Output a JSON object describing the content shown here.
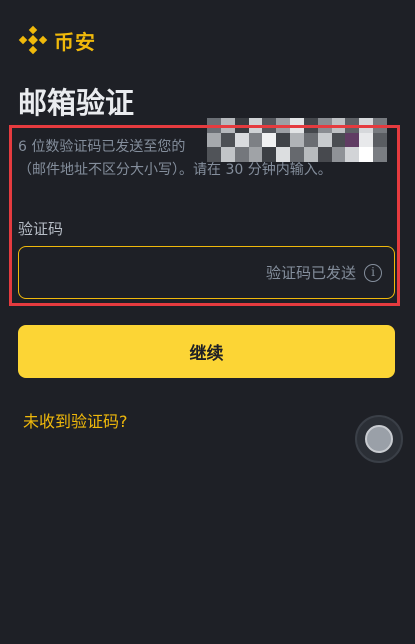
{
  "brand": {
    "name": "币安",
    "color": "#f0b90b"
  },
  "page": {
    "title": "邮箱验证",
    "description_line1": "6 位数验证码已发送至您的",
    "description_line2": "（邮件地址不区分大小写）。请在 30 分钟内输入。"
  },
  "form": {
    "code_label": "验证码",
    "code_value": "",
    "sent_status": "验证码已发送",
    "info_icon": "info-icon"
  },
  "actions": {
    "continue_label": "继续",
    "resend_link": "未收到验证码?"
  },
  "colors": {
    "background": "#1e2026",
    "accent": "#fcd535",
    "highlight": "#e53b3f"
  }
}
